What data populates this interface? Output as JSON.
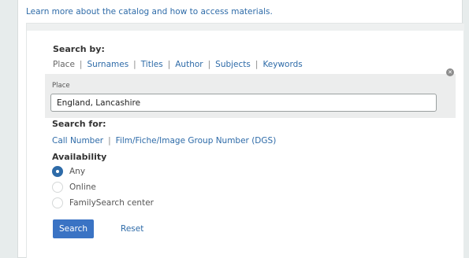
{
  "header": {
    "learn_more_link": "Learn more about the catalog and how to access materials."
  },
  "search_by": {
    "heading": "Search by:",
    "tabs": [
      {
        "label": "Place",
        "selected": true
      },
      {
        "label": "Surnames",
        "selected": false
      },
      {
        "label": "Titles",
        "selected": false
      },
      {
        "label": "Author",
        "selected": false
      },
      {
        "label": "Subjects",
        "selected": false
      },
      {
        "label": "Keywords",
        "selected": false
      }
    ]
  },
  "place_field": {
    "label": "Place",
    "value": "England, Lancashire",
    "clear_icon": "close-icon"
  },
  "search_for": {
    "heading": "Search for:",
    "tabs": [
      {
        "label": "Call Number"
      },
      {
        "label": "Film/Fiche/Image Group Number (DGS)"
      }
    ]
  },
  "availability": {
    "heading": "Availability",
    "options": [
      {
        "label": "Any",
        "checked": true
      },
      {
        "label": "Online",
        "checked": false
      },
      {
        "label": "FamilySearch center",
        "checked": false
      }
    ]
  },
  "actions": {
    "search_label": "Search",
    "reset_label": "Reset"
  },
  "colors": {
    "link": "#2e6ba8",
    "primary_button": "#3a73c4",
    "background": "#e7ecec"
  }
}
